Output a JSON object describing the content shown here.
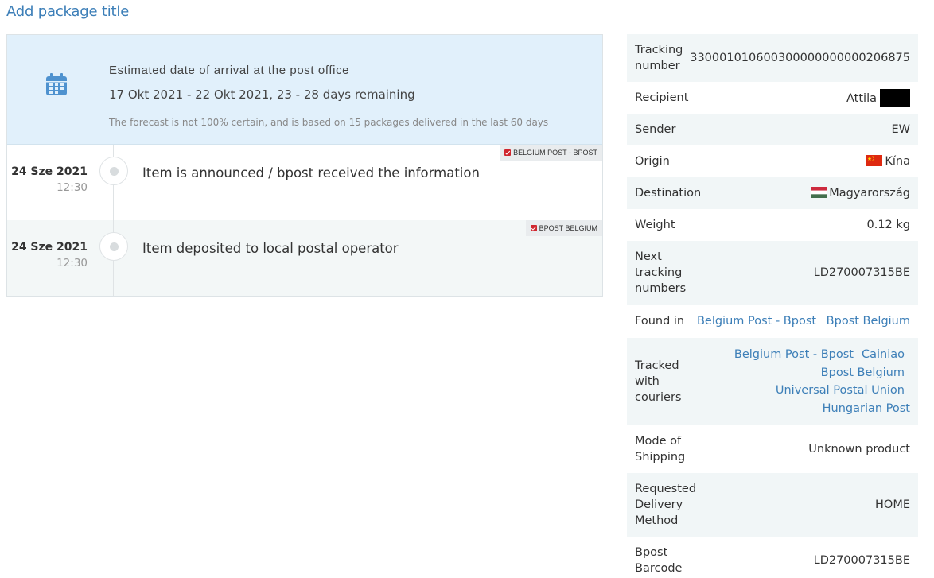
{
  "package_title_link": "Add package title",
  "estimate": {
    "heading": "Estimated date of arrival at the post office",
    "range": "17 Okt 2021 - 22 Okt 2021, 23 - 28 days remaining",
    "note": "The forecast is not 100% certain, and is based on 15 packages delivered in the last 60 days",
    "icon": "calendar-icon"
  },
  "events": [
    {
      "date": "24 Sze 2021",
      "time": "12:30",
      "description": "Item is announced / bpost received the information",
      "courier_badge": "BELGIUM POST - BPOST"
    },
    {
      "date": "24 Sze 2021",
      "time": "12:30",
      "description": "Item deposited to local postal operator",
      "courier_badge": "BPOST BELGIUM"
    }
  ],
  "details": {
    "tracking_number": {
      "label": "Tracking number",
      "value": "330001010600300000000000206875"
    },
    "recipient": {
      "label": "Recipient",
      "value": "Attila"
    },
    "sender": {
      "label": "Sender",
      "value": "EW"
    },
    "origin": {
      "label": "Origin",
      "value": "Kína",
      "flag": "china-flag"
    },
    "destination": {
      "label": "Destination",
      "value": "Magyarország",
      "flag": "hungary-flag"
    },
    "weight": {
      "label": "Weight",
      "value": "0.12 kg"
    },
    "next_tracking": {
      "label": "Next tracking numbers",
      "value": "LD270007315BE"
    },
    "found_in": {
      "label": "Found in",
      "links": [
        "Belgium Post - Bpost",
        "Bpost Belgium"
      ]
    },
    "tracked_with": {
      "label": "Tracked with couriers",
      "links": [
        "Belgium Post - Bpost",
        "Cainiao",
        "Bpost Belgium",
        "Universal Postal Union",
        "Hungarian Post"
      ]
    },
    "mode_of_shipping": {
      "label": "Mode of Shipping",
      "value": "Unknown product"
    },
    "requested_delivery": {
      "label": "Requested Delivery Method",
      "value": "HOME"
    },
    "bpost_barcode": {
      "label": "Bpost Barcode",
      "value": "LD270007315BE"
    }
  },
  "colors": {
    "link": "#3d7fb8",
    "estimate_bg": "#e1f0fb",
    "row_alt": "#f1f6f7",
    "badge_red": "#d0262e"
  }
}
